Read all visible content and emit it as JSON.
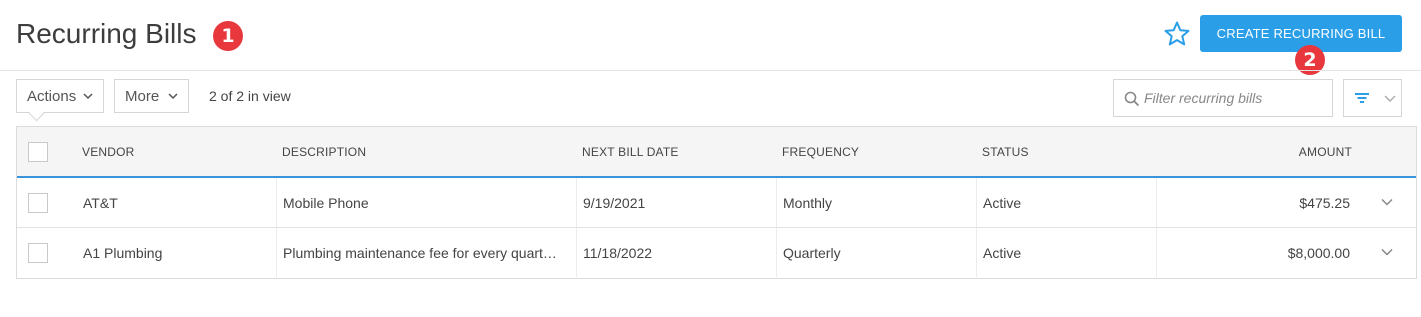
{
  "header": {
    "title": "Recurring Bills",
    "badge_1": "1",
    "badge_2": "2",
    "create_button_label": "CREATE RECURRING BILL"
  },
  "toolbar": {
    "actions_label": "Actions",
    "more_label": "More",
    "in_view_text": "2 of 2 in view",
    "filter_placeholder": "Filter recurring bills"
  },
  "table": {
    "columns": [
      "VENDOR",
      "DESCRIPTION",
      "NEXT BILL DATE",
      "FREQUENCY",
      "STATUS",
      "AMOUNT"
    ],
    "rows": [
      {
        "vendor": "AT&T",
        "description": "Mobile Phone",
        "next_bill_date": "9/19/2021",
        "frequency": "Monthly",
        "status": "Active",
        "amount": "$475.25"
      },
      {
        "vendor": "A1 Plumbing",
        "description": "Plumbing maintenance fee for every quart…",
        "next_bill_date": "11/18/2022",
        "frequency": "Quarterly",
        "status": "Active",
        "amount": "$8,000.00"
      }
    ]
  },
  "colors": {
    "primary": "#2b9ee8",
    "badge": "#e8383d",
    "header_underline": "#3b94d9"
  },
  "icons": [
    "star-icon",
    "chevron-down-icon",
    "search-icon",
    "filter-icon",
    "expand-row-icon"
  ]
}
